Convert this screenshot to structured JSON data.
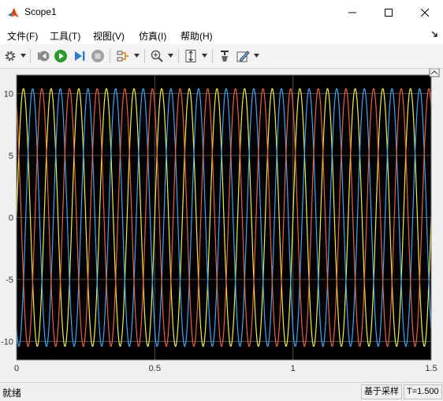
{
  "window": {
    "title": "Scope1",
    "minimize_icon": "minimize-icon",
    "maximize_icon": "maximize-icon",
    "close_icon": "close-icon"
  },
  "menu": {
    "items": [
      "文件(F)",
      "工具(T)",
      "视图(V)",
      "仿真(I)",
      "帮助(H)"
    ]
  },
  "toolbar": {
    "icons": [
      "gear-icon",
      "step-back-icon",
      "run-icon",
      "step-forward-icon",
      "stop-icon",
      "signal-select-icon",
      "zoom-icon",
      "autoscale-icon",
      "highlight-icon",
      "style-icon"
    ]
  },
  "chart_data": {
    "type": "line",
    "x_range": [
      0,
      1.5
    ],
    "ylim": [
      -11.5,
      11.5
    ],
    "xticks": [
      "0",
      "0.5",
      "1",
      "1.5"
    ],
    "yticks": [
      "10",
      "5",
      "0",
      "-5",
      "-10"
    ],
    "grid": true,
    "background": "#000000",
    "series": [
      {
        "color": "#f0f040",
        "amplitude": 10.4,
        "frequency": 10,
        "phase_deg": 0
      },
      {
        "color": "#3ea6f2",
        "amplitude": 10.4,
        "frequency": 10,
        "phase_deg": -120
      },
      {
        "color": "#e8643a",
        "amplitude": 10.4,
        "frequency": 10,
        "phase_deg": 120
      }
    ]
  },
  "status": {
    "left": "就绪",
    "sample_label": "基于采样",
    "time_label": "T=1.500"
  },
  "colors": {
    "axes": "#000000",
    "grid": "#4a4a4a",
    "ticks": "#ffffff"
  }
}
